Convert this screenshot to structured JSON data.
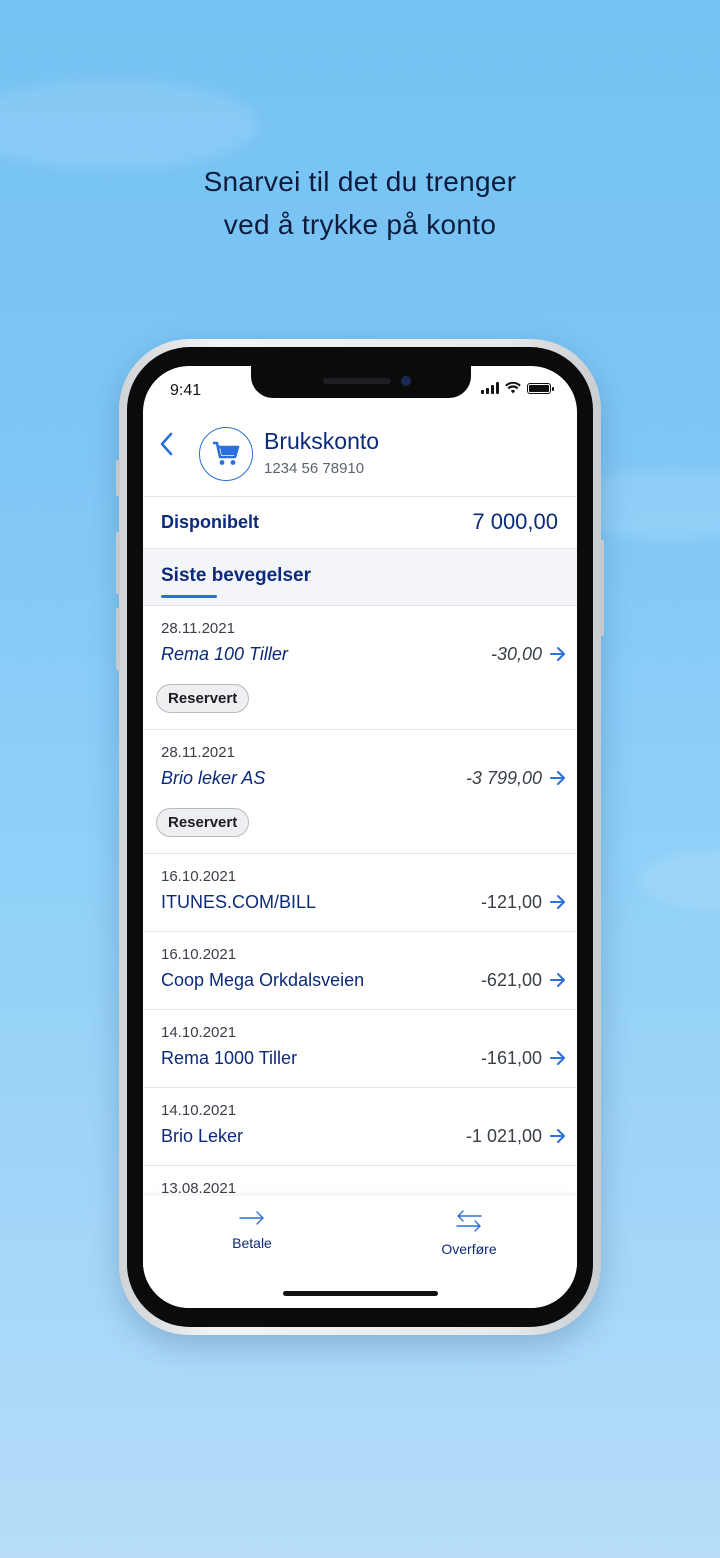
{
  "headline": {
    "line1": "Snarvei til det du trenger",
    "line2": "ved å trykke på konto"
  },
  "status_bar": {
    "time": "9:41"
  },
  "account": {
    "name": "Brukskonto",
    "number": "1234 56 78910"
  },
  "available": {
    "label": "Disponibelt",
    "amount": "7 000,00"
  },
  "section": {
    "title": "Siste bevegelser"
  },
  "transactions": [
    {
      "date": "28.11.2021",
      "description": "Rema 100 Tiller",
      "amount": "-30,00",
      "badge": "Reservert"
    },
    {
      "date": "28.11.2021",
      "description": "Brio leker AS",
      "amount": "-3 799,00",
      "badge": "Reservert"
    },
    {
      "date": "16.10.2021",
      "description": "ITUNES.COM/BILL",
      "amount": "-121,00"
    },
    {
      "date": "16.10.2021",
      "description": "Coop Mega Orkdalsveien",
      "amount": "-621,00"
    },
    {
      "date": "14.10.2021",
      "description": "Rema 1000 Tiller",
      "amount": "-161,00"
    },
    {
      "date": "14.10.2021",
      "description": "Brio Leker",
      "amount": "-1 021,00"
    },
    {
      "date": "13.08.2021",
      "description": "",
      "amount": ""
    }
  ],
  "tabbar": {
    "pay_label": "Betale",
    "transfer_label": "Overføre"
  },
  "icons": {
    "back": "chevron-left-icon",
    "account": "shopping-cart-icon",
    "row": "arrow-right-icon",
    "pay": "arrow-right-icon",
    "transfer": "transfer-arrows-icon"
  },
  "colors": {
    "accent": "#2a6fdb",
    "navy": "#0b2a79",
    "background": "#7dc6f5"
  }
}
